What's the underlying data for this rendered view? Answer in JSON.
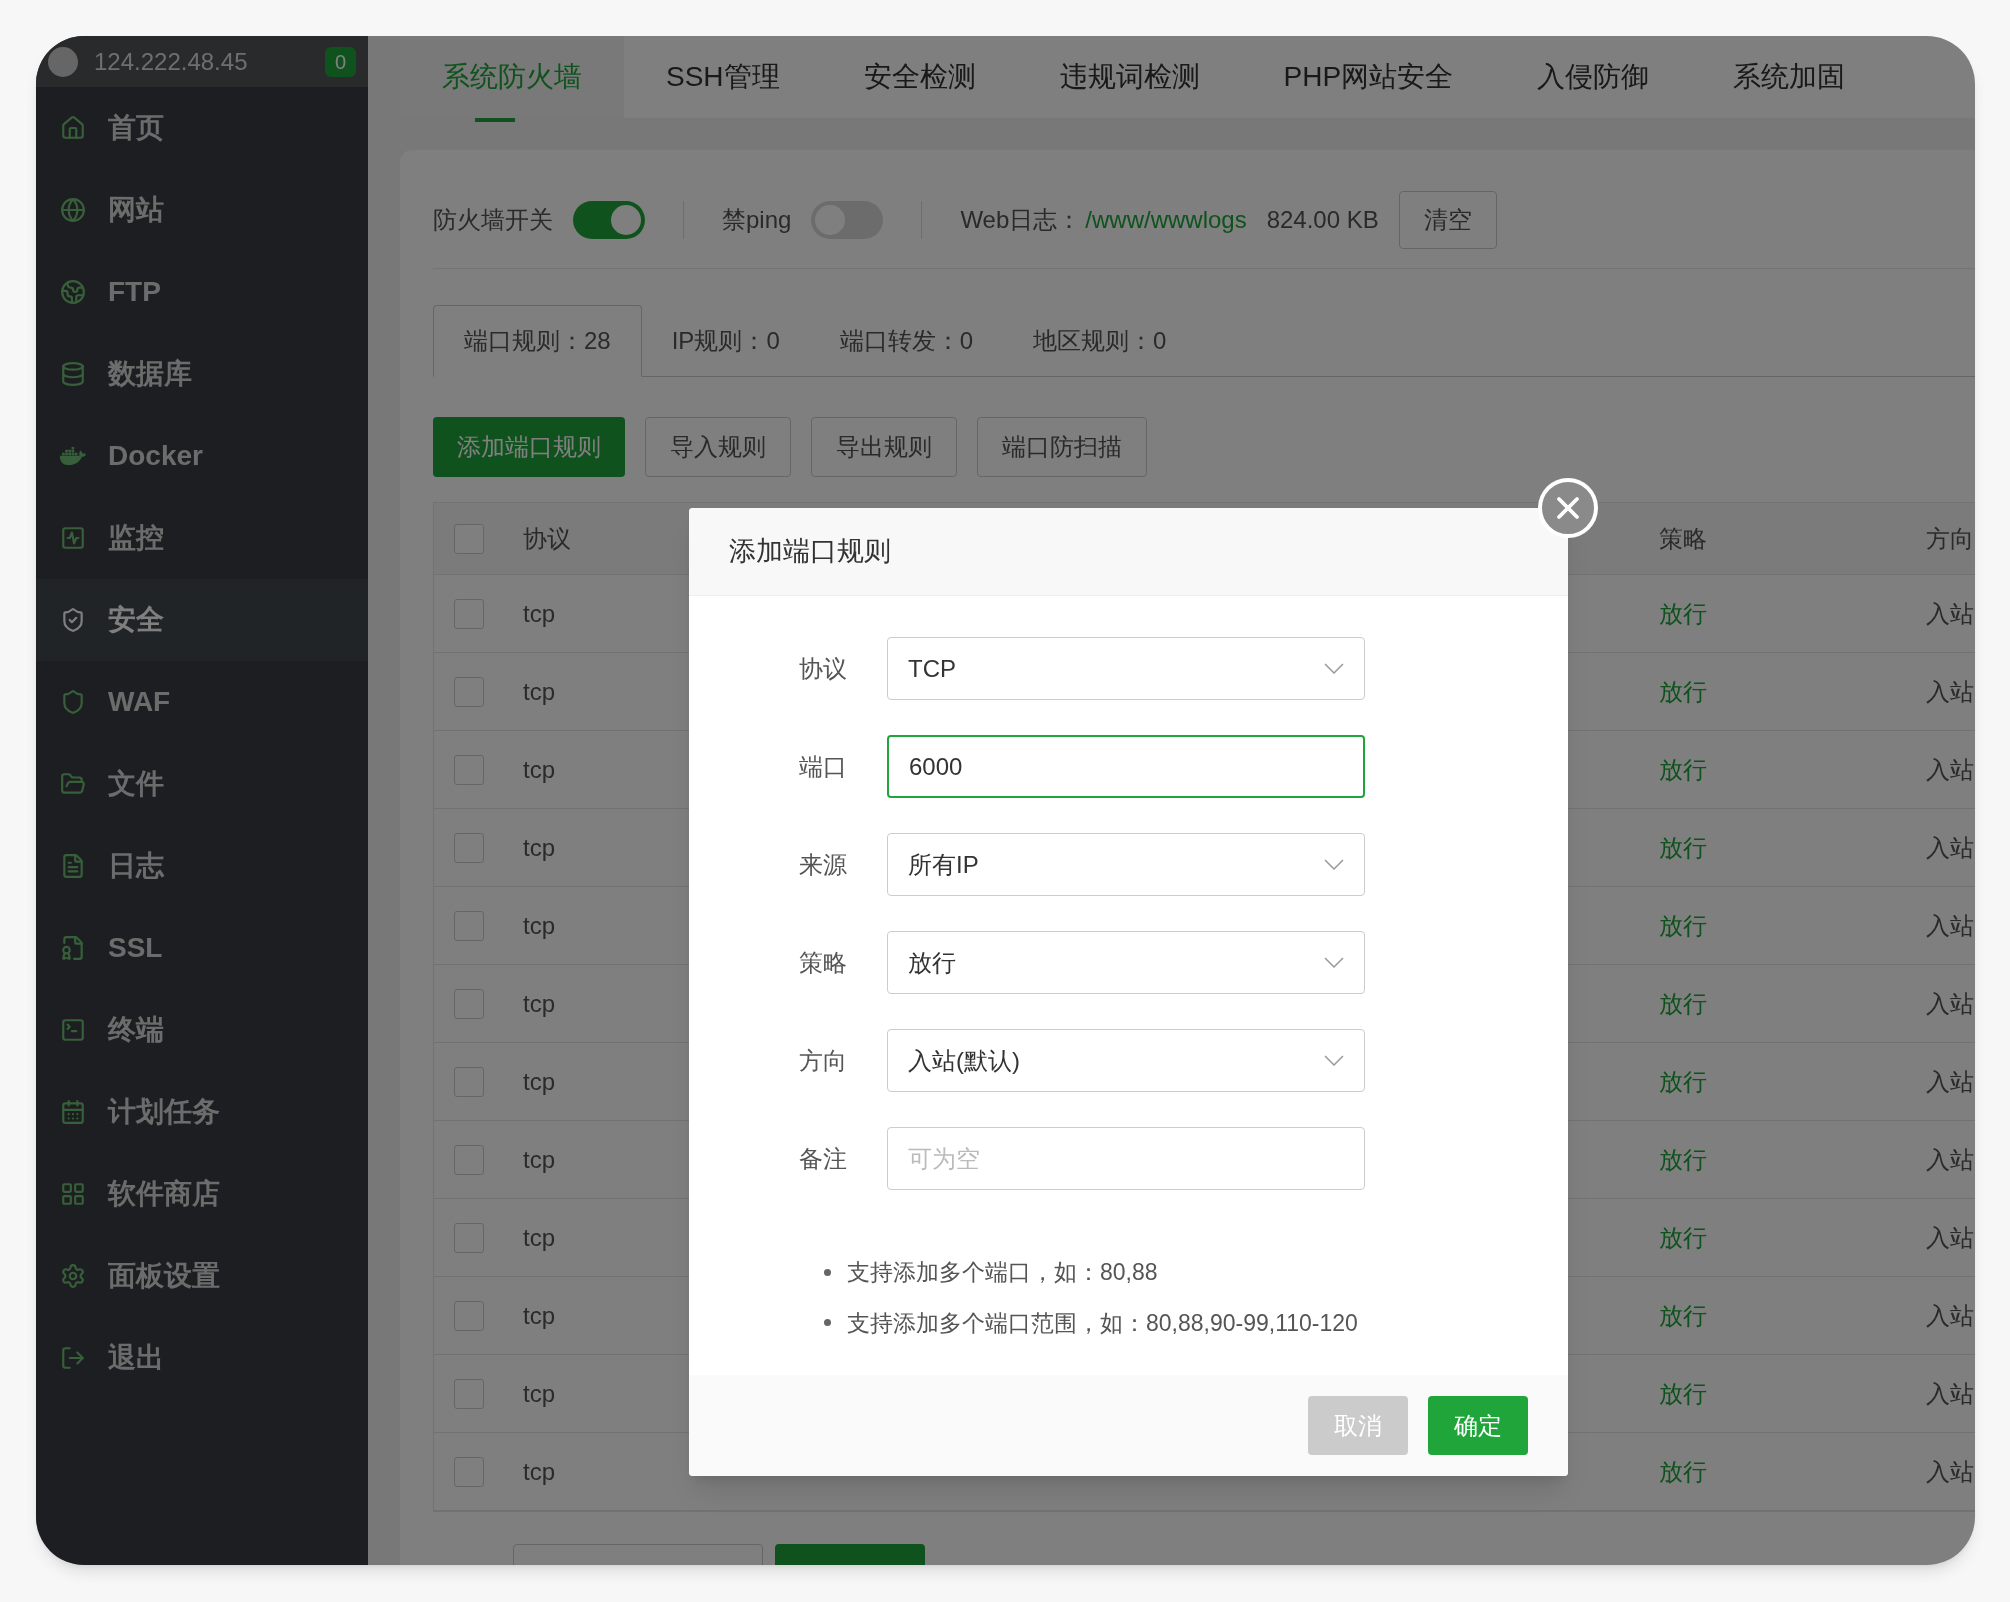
{
  "sidebar": {
    "host": "124.222.48.45",
    "badge": "0",
    "items": [
      {
        "label": "首页",
        "selected": false
      },
      {
        "label": "网站",
        "selected": false
      },
      {
        "label": "FTP",
        "selected": false
      },
      {
        "label": "数据库",
        "selected": false
      },
      {
        "label": "Docker",
        "selected": false
      },
      {
        "label": "监控",
        "selected": false
      },
      {
        "label": "安全",
        "selected": true
      },
      {
        "label": "WAF",
        "selected": false
      },
      {
        "label": "文件",
        "selected": false
      },
      {
        "label": "日志",
        "selected": false
      },
      {
        "label": "SSL",
        "selected": false
      },
      {
        "label": "终端",
        "selected": false
      },
      {
        "label": "计划任务",
        "selected": false
      },
      {
        "label": "软件商店",
        "selected": false
      },
      {
        "label": "面板设置",
        "selected": false
      },
      {
        "label": "退出",
        "selected": false
      }
    ]
  },
  "top_tabs": [
    {
      "label": "系统防火墙",
      "selected": true
    },
    {
      "label": "SSH管理",
      "selected": false
    },
    {
      "label": "安全检测",
      "selected": false
    },
    {
      "label": "违规词检测",
      "selected": false
    },
    {
      "label": "PHP网站安全",
      "selected": false
    },
    {
      "label": "入侵防御",
      "selected": false
    },
    {
      "label": "系统加固",
      "selected": false
    }
  ],
  "firewall": {
    "switch_label": "防火墙开关",
    "switch_on": true,
    "ping_label": "禁ping",
    "ping_on": false,
    "log_label": "Web日志：",
    "log_path": "/www/wwwlogs",
    "log_size": "824.00 KB",
    "clear_button": "清空"
  },
  "rule_tabs": [
    {
      "label": "端口规则：28",
      "selected": true
    },
    {
      "label": "IP规则：0",
      "selected": false
    },
    {
      "label": "端口转发：0",
      "selected": false
    },
    {
      "label": "地区规则：0",
      "selected": false
    }
  ],
  "actions": [
    {
      "label": "添加端口规则",
      "primary": true
    },
    {
      "label": "导入规则",
      "primary": false
    },
    {
      "label": "导出规则",
      "primary": false
    },
    {
      "label": "端口防扫描",
      "primary": false
    }
  ],
  "table": {
    "header_checked": false,
    "columns": [
      "协议",
      "策略",
      "方向"
    ],
    "rows": [
      {
        "protocol": "tcp",
        "policy": "放行",
        "direction": "入站",
        "checked": false
      },
      {
        "protocol": "tcp",
        "policy": "放行",
        "direction": "入站",
        "checked": false
      },
      {
        "protocol": "tcp",
        "policy": "放行",
        "direction": "入站",
        "checked": false
      },
      {
        "protocol": "tcp",
        "policy": "放行",
        "direction": "入站",
        "checked": false
      },
      {
        "protocol": "tcp",
        "policy": "放行",
        "direction": "入站",
        "checked": false
      },
      {
        "protocol": "tcp",
        "policy": "放行",
        "direction": "入站",
        "checked": false
      },
      {
        "protocol": "tcp",
        "policy": "放行",
        "direction": "入站",
        "checked": false
      },
      {
        "protocol": "tcp",
        "policy": "放行",
        "direction": "入站",
        "checked": false
      },
      {
        "protocol": "tcp",
        "policy": "放行",
        "direction": "入站",
        "checked": false
      },
      {
        "protocol": "tcp",
        "policy": "放行",
        "direction": "入站",
        "checked": false
      },
      {
        "protocol": "tcp",
        "policy": "放行",
        "direction": "入站",
        "checked": false
      },
      {
        "protocol": "tcp",
        "policy": "放行",
        "direction": "入站",
        "checked": false
      }
    ]
  },
  "dialog": {
    "title": "添加端口规则",
    "fields": [
      {
        "label": "协议",
        "kind": "select",
        "value": "TCP",
        "focused": false
      },
      {
        "label": "端口",
        "kind": "input",
        "value": "6000",
        "focused": true
      },
      {
        "label": "来源",
        "kind": "select",
        "value": "所有IP",
        "focused": false
      },
      {
        "label": "策略",
        "kind": "select",
        "value": "放行",
        "focused": false
      },
      {
        "label": "方向",
        "kind": "select",
        "value": "入站(默认)",
        "focused": false
      },
      {
        "label": "备注",
        "kind": "input",
        "placeholder": "可为空",
        "focused": false
      }
    ],
    "notes": [
      "支持添加多个端口，如：80,88",
      "支持添加多个端口范围，如：80,88,90-99,110-120"
    ],
    "buttons": [
      {
        "label": "取消",
        "kind": "cancel"
      },
      {
        "label": "确定",
        "kind": "confirm"
      }
    ]
  }
}
